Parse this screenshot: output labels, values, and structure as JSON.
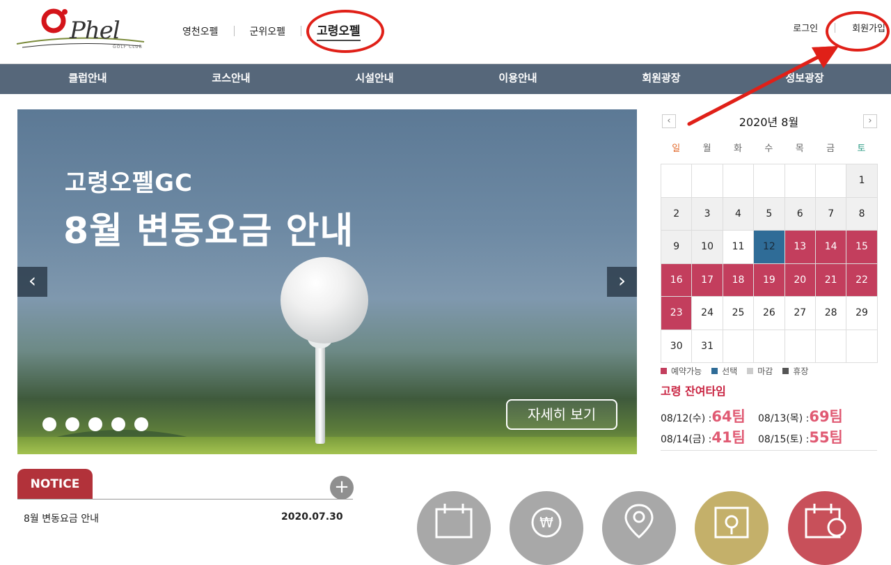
{
  "header": {
    "logo": {
      "text": "Phel",
      "sub": "GOLF CLUB"
    },
    "brand_tabs": [
      {
        "label": "영천오펠"
      },
      {
        "label": "군위오펠"
      },
      {
        "label": "고령오펠",
        "active": true
      }
    ],
    "top_links": {
      "login": "로그인",
      "signup": "회원가입"
    }
  },
  "nav": [
    "클럽안내",
    "코스안내",
    "시설안내",
    "이용안내",
    "회원광장",
    "정보광장"
  ],
  "banner": {
    "subtitle": "고령오펠GC",
    "title": "8월 변동요금 안내",
    "more_label": "자세히 보기",
    "prev_icon": "‹",
    "next_icon": "›",
    "slide_count": 5
  },
  "calendar": {
    "month_label": "2020년 8월",
    "prev": "‹",
    "next": "›",
    "weekdays": [
      "일",
      "월",
      "화",
      "수",
      "목",
      "금",
      "토"
    ],
    "weekday_colors": {
      "sun": "#e26a2c",
      "sat": "#2f9d86",
      "other": "#666666"
    },
    "status_colors": {
      "available": "#c33e5d",
      "selected": "#2f6c97",
      "closed": "#cccccc",
      "holiday": "#555555"
    },
    "legend": [
      {
        "label": "예약가능",
        "color": "#c33e5d"
      },
      {
        "label": "선택",
        "color": "#2f6c97"
      },
      {
        "label": "마감",
        "color": "#cccccc"
      },
      {
        "label": "휴장",
        "color": "#555555"
      }
    ],
    "cells": [
      [
        "",
        "",
        "",
        "",
        "",
        "",
        "1"
      ],
      [
        "2",
        "3",
        "4",
        "5",
        "6",
        "7",
        "8"
      ],
      [
        "9",
        "10",
        "11",
        "12",
        "13",
        "14",
        "15"
      ],
      [
        "16",
        "17",
        "18",
        "19",
        "20",
        "21",
        "22"
      ],
      [
        "23",
        "24",
        "25",
        "26",
        "27",
        "28",
        "29"
      ],
      [
        "30",
        "31",
        "",
        "",
        "",
        "",
        ""
      ]
    ],
    "status": [
      [
        "empty",
        "empty",
        "empty",
        "empty",
        "empty",
        "empty",
        "closed"
      ],
      [
        "closed",
        "closed",
        "closed",
        "closed",
        "closed",
        "closed",
        "closed"
      ],
      [
        "closed",
        "closed",
        "open",
        "selected",
        "available",
        "available",
        "available"
      ],
      [
        "available",
        "available",
        "available",
        "available",
        "available",
        "available",
        "available"
      ],
      [
        "available",
        "open",
        "open",
        "open",
        "open",
        "open",
        "open"
      ],
      [
        "open",
        "open",
        "empty",
        "empty",
        "empty",
        "empty",
        "empty"
      ]
    ]
  },
  "remaining": {
    "title": "고령 잔여타임",
    "items": [
      {
        "date": "08/12(수) :",
        "count": "64팀"
      },
      {
        "date": "08/13(목) :",
        "count": "69팀"
      },
      {
        "date": "08/14(금) :",
        "count": "41팀"
      },
      {
        "date": "08/15(토) :",
        "count": "55팀"
      }
    ]
  },
  "notice": {
    "tab_label": "NOTICE",
    "plus": "+",
    "items": [
      {
        "title": "8월 변동요금 안내",
        "date": "2020.07.30"
      }
    ]
  },
  "quick_icons": [
    "calendar-icon",
    "won-icon",
    "location-icon",
    "shield-icon",
    "schedule-icon"
  ],
  "annotation_color": "#e02018"
}
